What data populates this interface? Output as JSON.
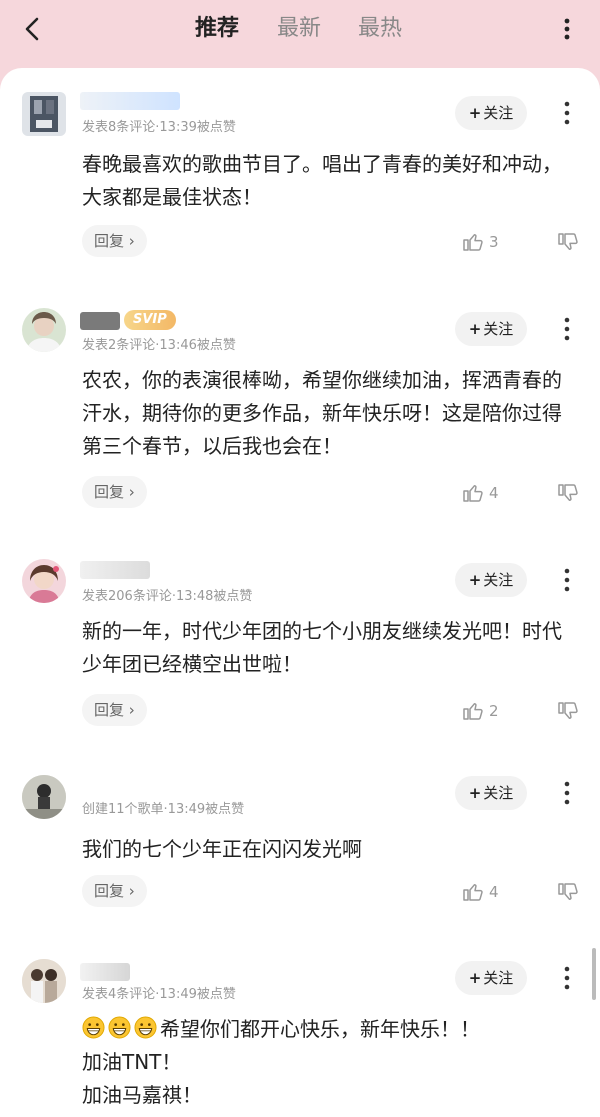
{
  "tabs": [
    {
      "label": "推荐"
    },
    {
      "label": "最新"
    },
    {
      "label": "最热"
    }
  ],
  "comments": [
    {
      "meta": "发表8条评论·13:39被点赞",
      "text": "春晚最喜欢的歌曲节目了。唱出了青春的美好和冲动，大家都是最佳状态！",
      "follow": "关注",
      "reply": "回复",
      "likes": "3"
    },
    {
      "badge": "SVIP",
      "meta": "发表2条评论·13:46被点赞",
      "text": "农农，你的表演很棒呦，希望你继续加油，挥洒青春的汗水，期待你的更多作品，新年快乐呀！这是陪你过得第三个春节，以后我也会在！",
      "follow": "关注",
      "reply": "回复",
      "likes": "4"
    },
    {
      "meta": "发表206条评论·13:48被点赞",
      "text": "新的一年，时代少年团的七个小朋友继续发光吧！时代少年团已经横空出世啦！",
      "follow": "关注",
      "reply": "回复",
      "likes": "2"
    },
    {
      "meta": "创建11个歌单·13:49被点赞",
      "text": "我们的七个少年正在闪闪发光啊",
      "follow": "关注",
      "reply": "回复",
      "likes": "4"
    },
    {
      "meta": "发表4条评论·13:49被点赞",
      "text_line1": "希望你们都开心快乐，新年快乐！！",
      "text_line2": "加油TNT！",
      "text_line3": "加油马嘉祺！",
      "follow": "关注"
    }
  ],
  "colors": {
    "header_bg": "#f6d7dc",
    "svip_badge": "#f3b866"
  },
  "icons": [
    "back-arrow-icon",
    "more-vertical-icon",
    "thumb-up-icon",
    "thumb-down-icon",
    "chevron-right-icon",
    "grinning-emoji-icon"
  ]
}
